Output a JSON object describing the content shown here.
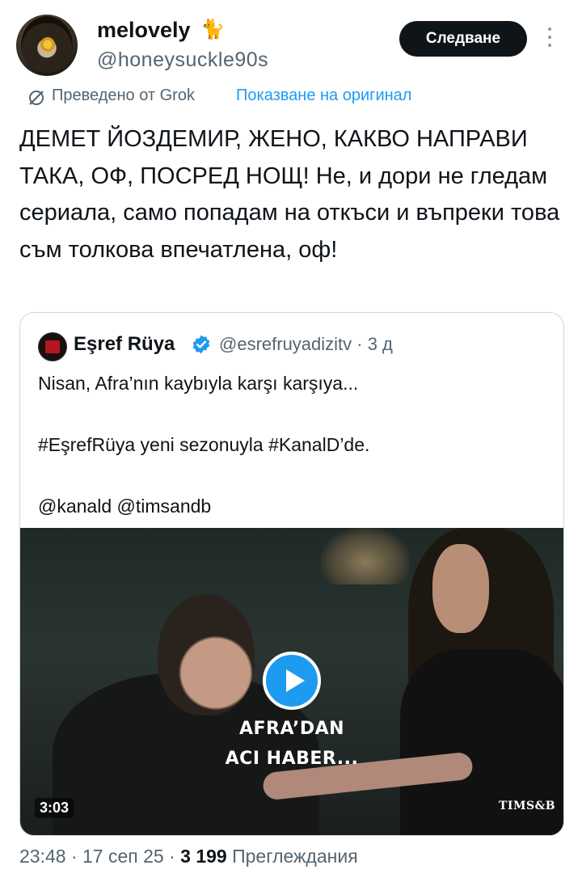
{
  "author": {
    "display_name": "melovely",
    "emoji": "🐈",
    "handle": "@honeysuckle90s"
  },
  "follow_button": "Следване",
  "translation": {
    "translated_by": "Преведено от Grok",
    "show_original": "Показване на оригинал"
  },
  "tweet_text": "ДЕМЕТ ЙОЗДЕМИР, ЖЕНО, КАКВО НАПРАВИ ТАКА, ОФ, ПОСРЕД НОЩ! Не, и дори не гледам сериала, само попадам на откъси и въпреки това съм толкова впечатлена, оф!",
  "quoted": {
    "name": "Eşref Rüya",
    "handle_time": "@esrefruyadizitv · 3 д",
    "text": "Nisan, Afra’nın kaybıyla karşı karşıya...\n\n#EşrefRüya yeni sezonuyla #KanalD’de.\n\n@kanald @timsandb",
    "video": {
      "caption_line1": "AFRA’DAN",
      "caption_line2": "ACI HABER...",
      "duration": "3:03",
      "logo": "TIMS&B"
    }
  },
  "meta": {
    "timestamp": "23:48 · 17 сеп 25 ·",
    "views_count": "3 199",
    "views_label": "Преглеждания"
  },
  "colors": {
    "accent": "#1d9bf0",
    "text": "#0f1419",
    "muted": "#536471",
    "border": "#cfd9de"
  }
}
